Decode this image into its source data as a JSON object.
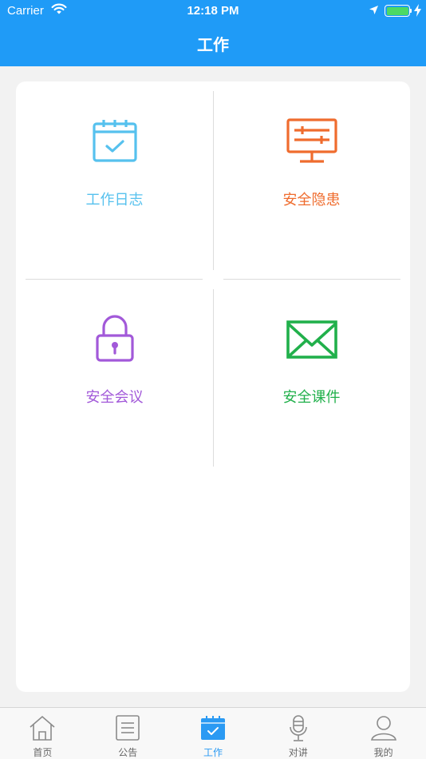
{
  "status_bar": {
    "carrier": "Carrier",
    "time": "12:18 PM"
  },
  "nav": {
    "title": "工作"
  },
  "tiles": [
    {
      "label": "工作日志",
      "icon": "calendar-check-icon",
      "color": "#56c1ee"
    },
    {
      "label": "安全隐患",
      "icon": "monitor-sliders-icon",
      "color": "#ef6c2e"
    },
    {
      "label": "安全会议",
      "icon": "lock-icon",
      "color": "#a259d9"
    },
    {
      "label": "安全课件",
      "icon": "envelope-icon",
      "color": "#21b04b"
    }
  ],
  "tabbar": {
    "items": [
      {
        "label": "首页",
        "icon": "home-icon"
      },
      {
        "label": "公告",
        "icon": "document-list-icon"
      },
      {
        "label": "工作",
        "icon": "calendar-check-icon",
        "active": true
      },
      {
        "label": "对讲",
        "icon": "microphone-icon"
      },
      {
        "label": "我的",
        "icon": "user-icon"
      }
    ],
    "active_color": "#2b9af3"
  },
  "colors": {
    "nav_bg": "#1f9bf7",
    "battery_fill": "#4cd964"
  }
}
